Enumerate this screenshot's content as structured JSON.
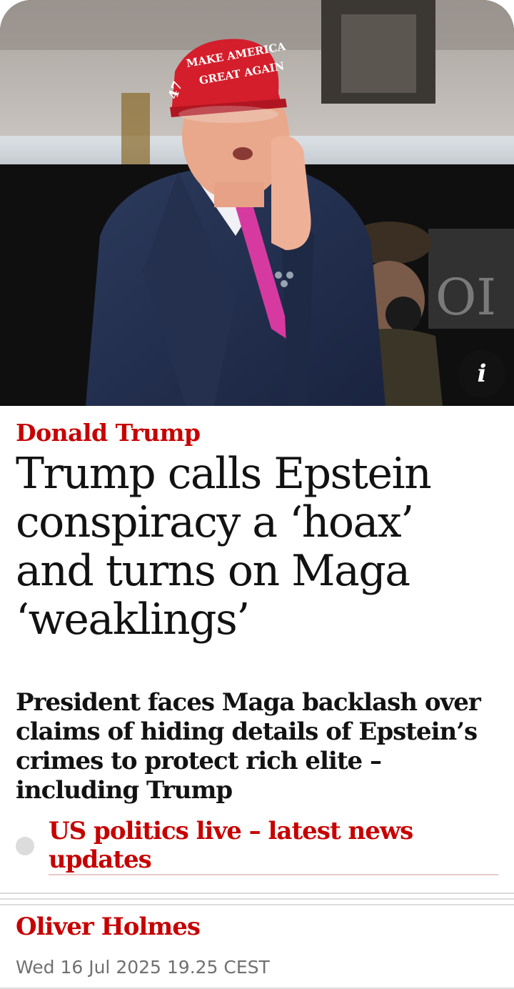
{
  "hero": {
    "caption_info_icon": "info-icon",
    "info_label": "i",
    "cap_text_line1": "MAKE AMERICA",
    "cap_text_line2": "GREAT AGAIN",
    "cap_side_text": "47"
  },
  "article": {
    "kicker": "Donald Trump",
    "headline": "Trump calls Epstein conspiracy a ‘hoax’ and turns on Maga ‘weaklings’",
    "standfirst": "President faces Maga backlash over claims of hiding details of Epstein’s crimes to protect rich elite – including Trump",
    "live_link": "US politics live – latest news updates",
    "byline": "Oliver Holmes",
    "date": "Wed 16 Jul 2025 19.25 CEST"
  },
  "colors": {
    "accent": "#c70000",
    "text": "#121212",
    "muted": "#707070",
    "rule": "#dcdcdc"
  }
}
